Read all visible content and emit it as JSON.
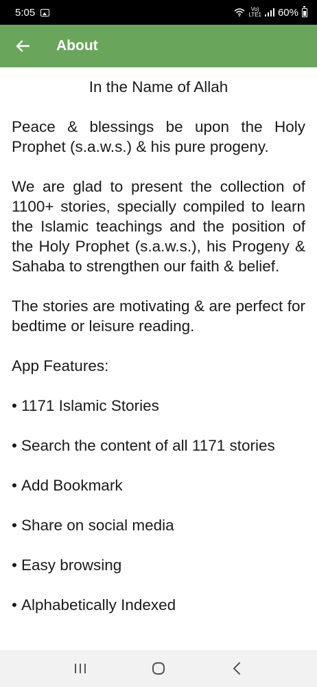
{
  "status_bar": {
    "time": "5:05",
    "network_label": "Vo)\nLTE1",
    "battery_percent": "60%"
  },
  "app_bar": {
    "title": "About"
  },
  "content": {
    "heading": "In the Name of Allah",
    "paragraphs": [
      "Peace & blessings be upon the Holy Prophet (s.a.w.s.) & his pure progeny.",
      "We are glad to present the collection of 1100+ stories, specially compiled to learn the Islamic teachings and the position of the Holy Prophet (s.a.w.s.), his Progeny & Sahaba to strengthen our faith & belief.",
      "The stories are motivating & are perfect for bedtime or leisure reading."
    ],
    "features_title": "App Features:",
    "features": [
      "1171 Islamic Stories",
      "Search the content of all 1171 stories",
      "Add Bookmark",
      "Share on social media",
      "Easy browsing",
      "Alphabetically Indexed"
    ],
    "bullet": "•"
  },
  "colors": {
    "app_bar": "#69a55b",
    "status_bar": "#000000",
    "nav_bar": "#f2f2f2"
  },
  "icons": {
    "back": "arrow-left-icon",
    "recents": "recent-apps-icon",
    "home": "home-icon",
    "nav_back": "chevron-left-icon"
  }
}
